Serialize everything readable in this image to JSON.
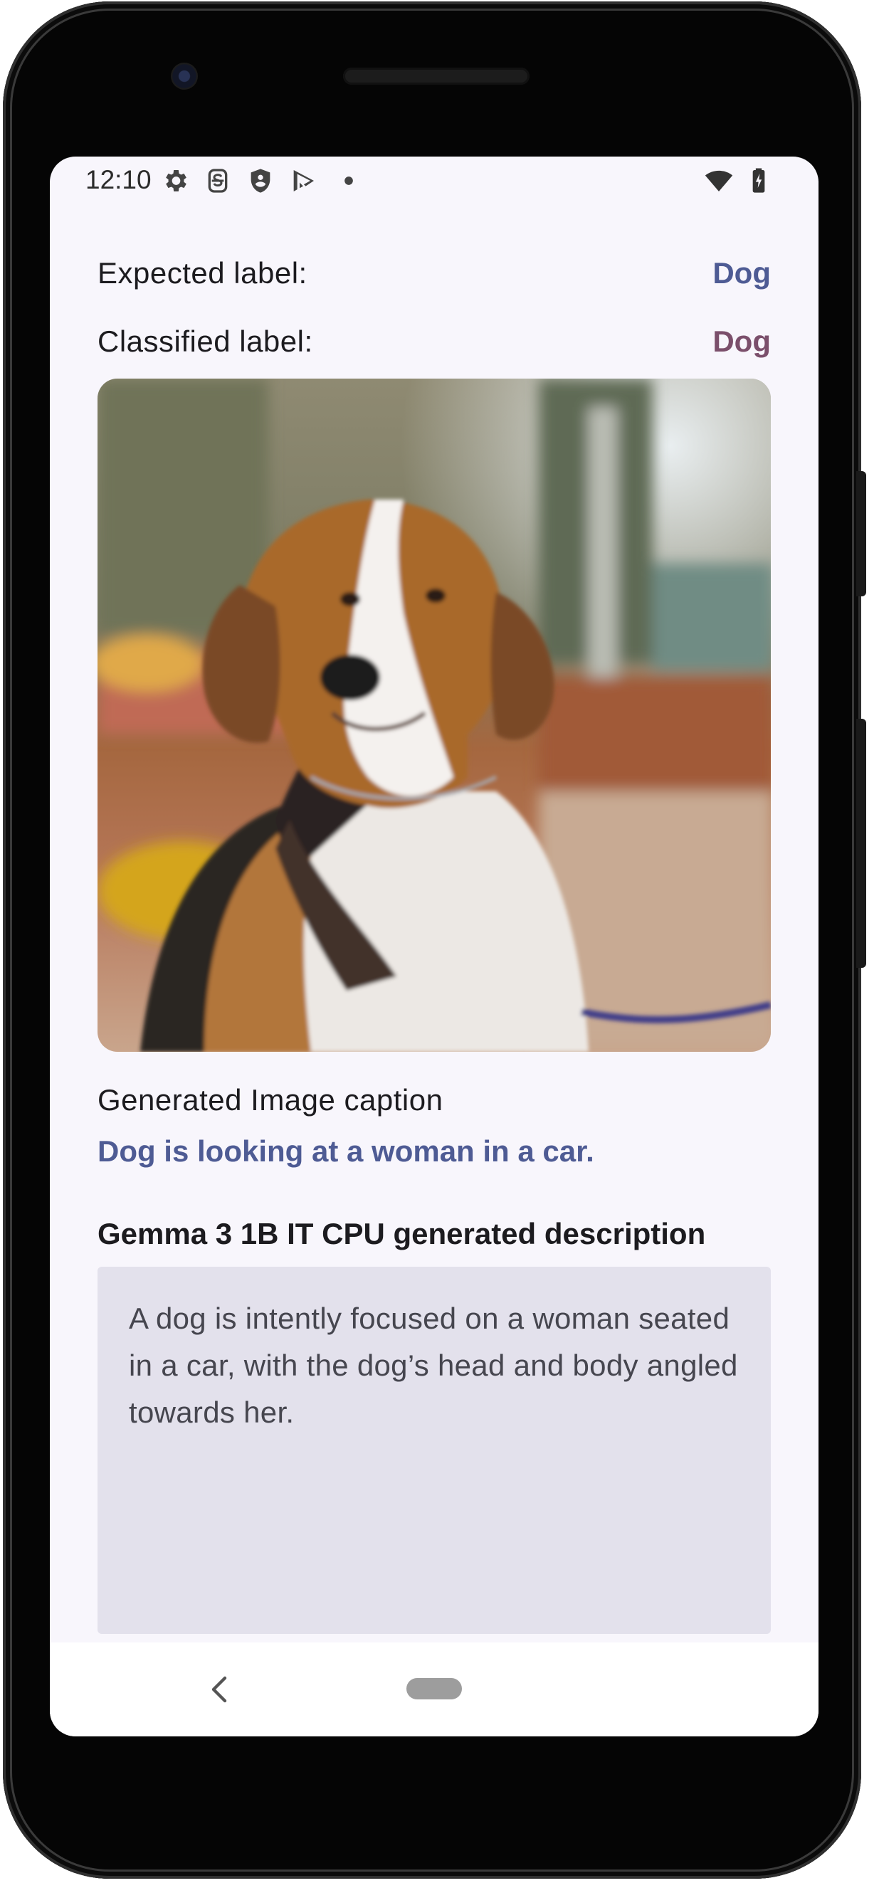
{
  "status_bar": {
    "time": "12:10",
    "left_icons": [
      "gear-icon",
      "s-badge-icon",
      "shield-icon",
      "play-store-icon",
      "dot-icon"
    ],
    "right_icons": [
      "wifi-icon",
      "battery-charging-icon"
    ]
  },
  "classification": {
    "expected_label_caption": "Expected label:",
    "expected_label_value": "Dog",
    "classified_label_caption": "Classified label:",
    "classified_label_value": "Dog",
    "expected_color": "#4e5b94",
    "classified_color": "#7b4f6b"
  },
  "image": {
    "subject": "dog-photo"
  },
  "caption_section": {
    "heading": "Generated Image caption",
    "caption": "Dog is looking at a woman in a car."
  },
  "description_section": {
    "title": "Gemma 3 1B IT CPU generated description",
    "text": "A dog is intently focused on a woman seated in a car, with the dog’s head and body angled towards her."
  },
  "nav_bar": {
    "icons": [
      "back-icon",
      "home-pill-icon"
    ]
  }
}
